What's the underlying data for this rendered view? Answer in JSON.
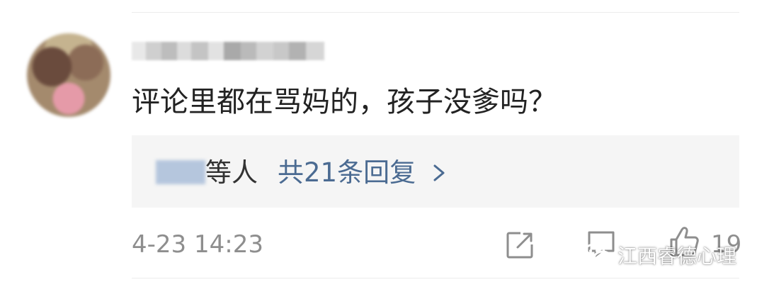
{
  "comment": {
    "text": "评论里都在骂妈的，孩子没爹吗？",
    "timestamp": "4-23 14:23",
    "like_count": "19"
  },
  "replies": {
    "suffix": "等人",
    "count_label": "共21条回复"
  },
  "watermark": {
    "text": "江西睿德心理"
  },
  "icons": {
    "share": "share-icon",
    "comment": "comment-icon",
    "like": "thumbs-up-icon",
    "chevron": "chevron-right-icon",
    "watermark": "wechat-icon"
  },
  "colors": {
    "link": "#4b6b92",
    "text": "#222222",
    "meta": "#8e8e8e",
    "reply_background": "#f5f5f5"
  }
}
